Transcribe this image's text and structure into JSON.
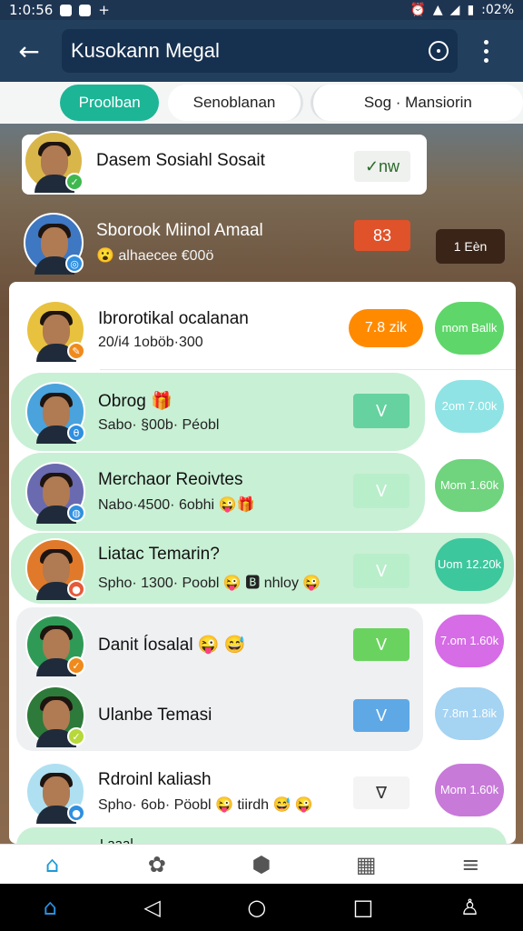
{
  "status": {
    "time": "1:0:56",
    "battery": ":02%"
  },
  "appbar": {
    "title": "Kusokann Megal"
  },
  "tabs": [
    "Proolban",
    "Senoblanan",
    "Sog · Mansiorin"
  ],
  "rows": [
    {
      "name": "Dasem Sosiahl Sosait",
      "sub": "",
      "action": "✓nw",
      "pill": ""
    },
    {
      "name": "Sborook Miinol Amaal",
      "sub": "😮 alhaecee €00ö",
      "action": "83",
      "pill": "1 Eèn"
    },
    {
      "name": "Ibrorotikal ocalanan",
      "sub": "20/i4 1oböb·300",
      "action": "7.8 zik",
      "pill": "mom Ballk"
    },
    {
      "name": "Obrog 🎁",
      "sub": "Sabo· §00b· Péobl",
      "action": "V",
      "pill": "2om 7.00k"
    },
    {
      "name": "Merchaor Reoivtes",
      "sub": "Nabo·4500· 6obhi 😜🎁",
      "action": "V",
      "pill": "Mom 1.60k"
    },
    {
      "name": "Liatac Temarin?",
      "sub": "Spho· 1300· Poobl 😜 🅱 nhloy 😜",
      "action": "V",
      "pill": "Uom 12.20k"
    },
    {
      "name": "Danit Íosalal 😜 😅",
      "sub": "",
      "action": "V",
      "pill": "7.om 1.60k"
    },
    {
      "name": "Ulanbe Temasi",
      "sub": "",
      "action": "V",
      "pill": "7.8m 1.8ik"
    },
    {
      "name": "Rdroinl kaliash",
      "sub": "Spho· 6ob· Pöobl 😜 tiirdh 😅 😜",
      "action": "∇",
      "pill": "Mom 1.60k"
    }
  ],
  "partial_row": {
    "name": "Laaal"
  },
  "colors": {
    "teal": "#1cb596",
    "orange": "#ff8a00",
    "green": "#5fd66a",
    "violet": "#d66ce6",
    "blue": "#5ea8e6"
  }
}
